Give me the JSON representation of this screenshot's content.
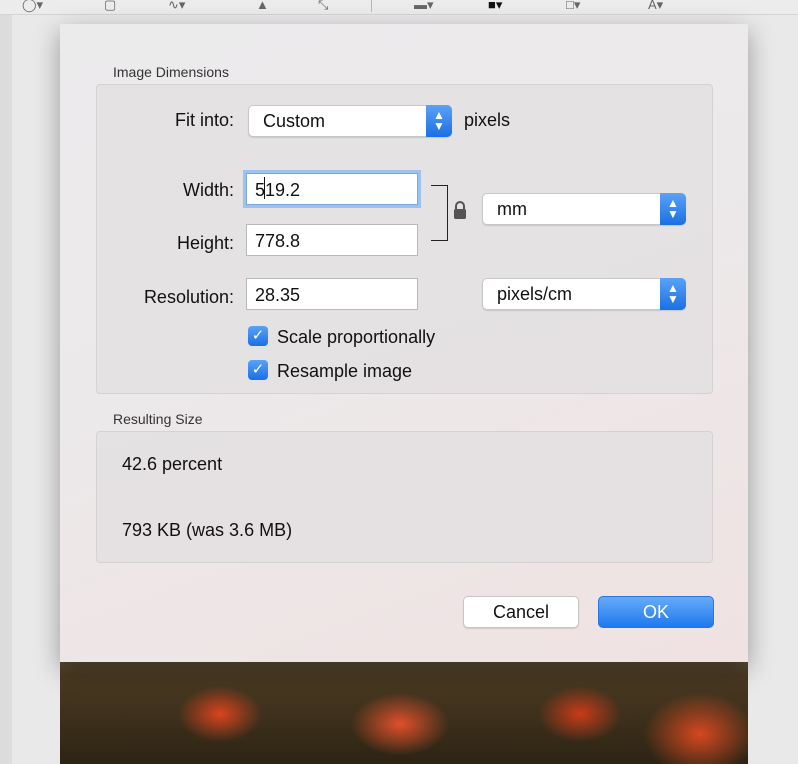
{
  "toolbar": {
    "icons": [
      "lasso-icon",
      "image-icon",
      "signature-icon",
      "adjust-icon",
      "resize-icon",
      "line-style-icon",
      "border-color-icon",
      "fill-color-icon",
      "text-style-icon"
    ]
  },
  "dialog": {
    "dimensions_label": "Image Dimensions",
    "fit_into_label": "Fit into:",
    "fit_into_value": "Custom",
    "fit_into_unit": "pixels",
    "width_label": "Width:",
    "width_value": "519.2",
    "height_label": "Height:",
    "height_value": "778.8",
    "size_unit_value": "mm",
    "resolution_label": "Resolution:",
    "resolution_value": "28.35",
    "resolution_unit_value": "pixels/cm",
    "scale_proportionally_label": "Scale proportionally",
    "scale_proportionally_checked": true,
    "resample_label": "Resample image",
    "resample_checked": true,
    "resulting_size_label": "Resulting Size",
    "percent_text": "42.6 percent",
    "size_text": "793 KB (was 3.6 MB)",
    "cancel_label": "Cancel",
    "ok_label": "OK"
  },
  "colors": {
    "accent": "#1c6fe4",
    "focus_ring": "#9cc2f2"
  }
}
